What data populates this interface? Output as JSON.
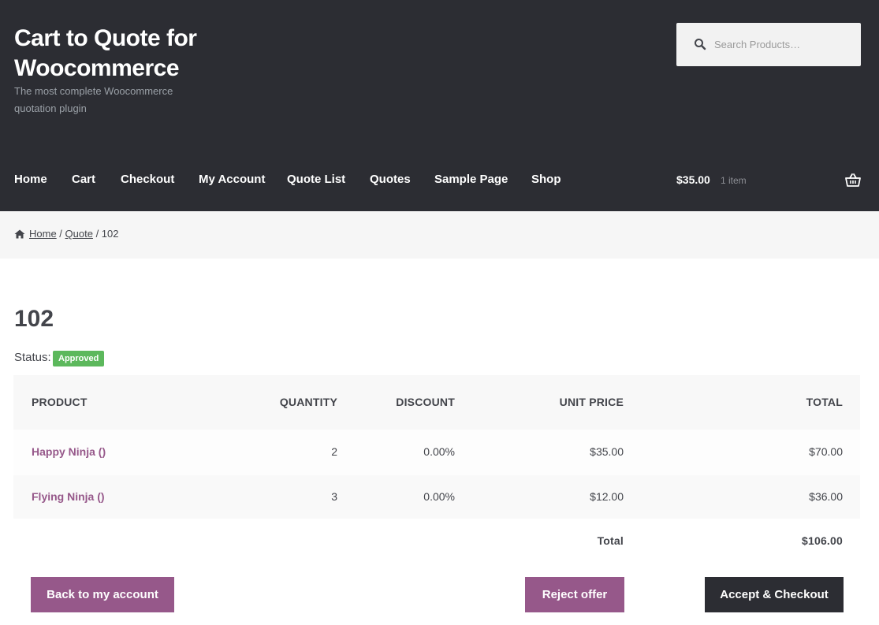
{
  "site": {
    "title": "Cart to Quote for Woocommerce",
    "description": "The most complete Woocommerce quotation plugin"
  },
  "search": {
    "placeholder": "Search Products…"
  },
  "nav": {
    "items": [
      "Home",
      "Cart",
      "Checkout",
      "My Account",
      "Quote List",
      "Quotes",
      "Sample Page",
      "Shop"
    ]
  },
  "cart": {
    "amount": "$35.00",
    "count": "1 item"
  },
  "breadcrumb": {
    "home": "Home",
    "sep1": " / ",
    "quote": "Quote",
    "sep2": " / ",
    "current": "102"
  },
  "quote": {
    "title": "102",
    "status_label": "Status:",
    "status": "Approved",
    "status_color": "#5cb85c"
  },
  "table": {
    "headers": {
      "product": "PRODUCT",
      "quantity": "QUANTITY",
      "discount": "DISCOUNT",
      "unit_price": "UNIT PRICE",
      "total": "TOTAL"
    },
    "rows": [
      {
        "product": "Happy Ninja ()",
        "quantity": "2",
        "discount": "0.00%",
        "unit_price": "$35.00",
        "total": "$70.00"
      },
      {
        "product": "Flying Ninja ()",
        "quantity": "3",
        "discount": "0.00%",
        "unit_price": "$12.00",
        "total": "$36.00"
      }
    ],
    "footer": {
      "label": "Total",
      "value": "$106.00"
    }
  },
  "actions": {
    "back": "Back to my account",
    "reject": "Reject offer",
    "accept": "Accept & Checkout"
  },
  "colors": {
    "header_bg": "#2c2d33",
    "accent": "#96588a",
    "dark_button": "#2c2d33"
  }
}
